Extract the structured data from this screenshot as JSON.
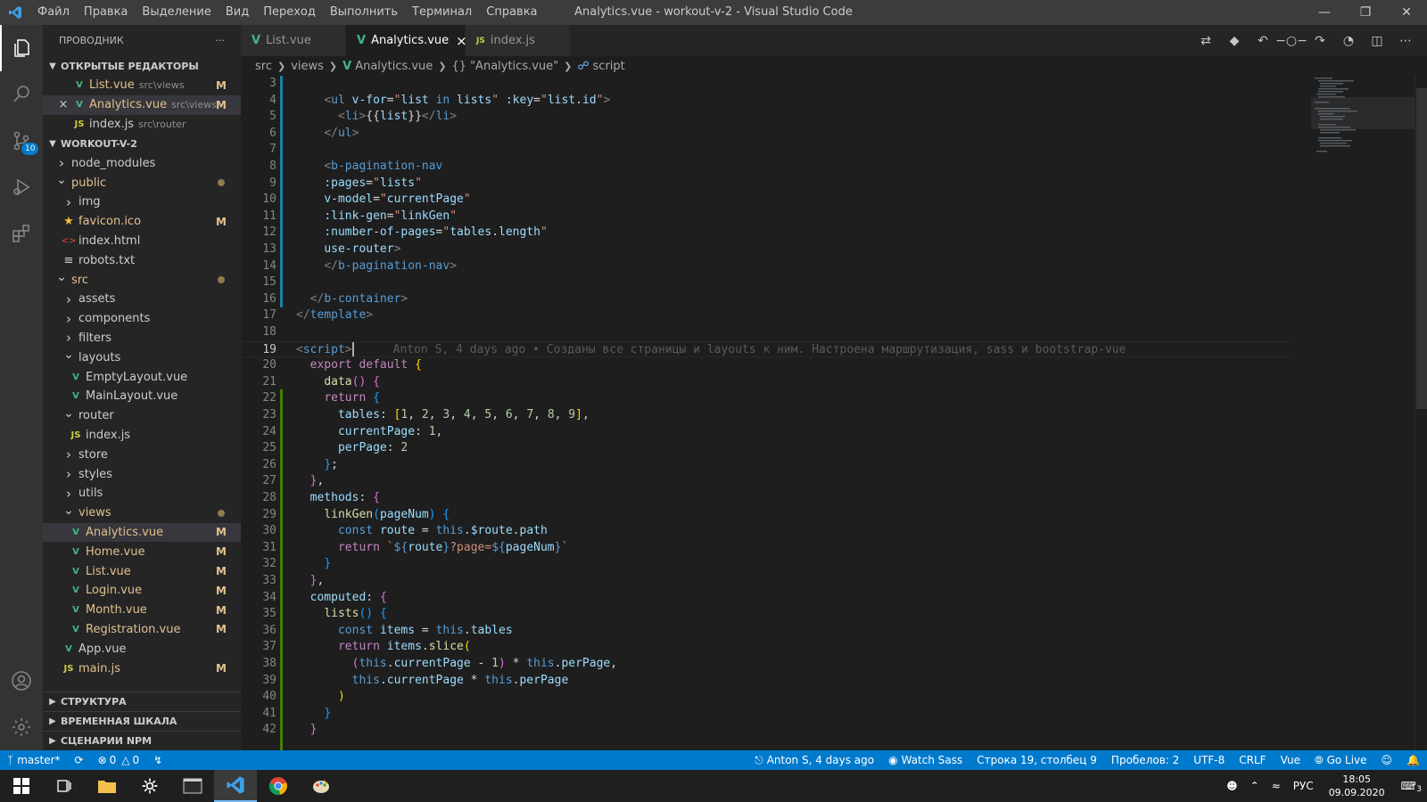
{
  "titlebar": {
    "menu": [
      "Файл",
      "Правка",
      "Выделение",
      "Вид",
      "Переход",
      "Выполнить",
      "Терминал",
      "Справка"
    ],
    "title": "Analytics.vue - workout-v-2 - Visual Studio Code"
  },
  "activity": {
    "scm_badge": "10"
  },
  "sidebar": {
    "header": "ПРОВОДНИК",
    "more": "···",
    "open_editors_title": "ОТКРЫТЫЕ РЕДАКТОРЫ",
    "open_editors": [
      {
        "name": "List.vue",
        "path": "src\\views",
        "mark": "M",
        "type": "vue"
      },
      {
        "name": "Analytics.vue",
        "path": "src\\views",
        "mark": "M",
        "type": "vue"
      },
      {
        "name": "index.js",
        "path": "src\\router",
        "mark": "",
        "type": "js"
      }
    ],
    "project_title": "WORKOUT-V-2",
    "tree": [
      {
        "name": "node_modules",
        "type": "folder-closed",
        "depth": 0
      },
      {
        "name": "public",
        "type": "folder-open",
        "depth": 0,
        "modified": true,
        "dot": true
      },
      {
        "name": "img",
        "type": "folder-closed",
        "depth": 1
      },
      {
        "name": "favicon.ico",
        "type": "star",
        "depth": 1,
        "modified": true,
        "mark": "M"
      },
      {
        "name": "index.html",
        "type": "html",
        "depth": 1
      },
      {
        "name": "robots.txt",
        "type": "txt",
        "depth": 1
      },
      {
        "name": "src",
        "type": "folder-open",
        "depth": 0,
        "modified": true,
        "dot": true
      },
      {
        "name": "assets",
        "type": "folder-closed",
        "depth": 1
      },
      {
        "name": "components",
        "type": "folder-closed",
        "depth": 1
      },
      {
        "name": "filters",
        "type": "folder-closed",
        "depth": 1
      },
      {
        "name": "layouts",
        "type": "folder-open",
        "depth": 1
      },
      {
        "name": "EmptyLayout.vue",
        "type": "vue",
        "depth": 2
      },
      {
        "name": "MainLayout.vue",
        "type": "vue",
        "depth": 2
      },
      {
        "name": "router",
        "type": "folder-open",
        "depth": 1
      },
      {
        "name": "index.js",
        "type": "js",
        "depth": 2
      },
      {
        "name": "store",
        "type": "folder-closed",
        "depth": 1
      },
      {
        "name": "styles",
        "type": "folder-closed",
        "depth": 1
      },
      {
        "name": "utils",
        "type": "folder-closed",
        "depth": 1
      },
      {
        "name": "views",
        "type": "folder-open",
        "depth": 1,
        "modified": true,
        "dot": true
      },
      {
        "name": "Analytics.vue",
        "type": "vue",
        "depth": 2,
        "modified": true,
        "mark": "M",
        "selected": true
      },
      {
        "name": "Home.vue",
        "type": "vue",
        "depth": 2,
        "modified": true,
        "mark": "M"
      },
      {
        "name": "List.vue",
        "type": "vue",
        "depth": 2,
        "modified": true,
        "mark": "M"
      },
      {
        "name": "Login.vue",
        "type": "vue",
        "depth": 2,
        "modified": true,
        "mark": "M"
      },
      {
        "name": "Month.vue",
        "type": "vue",
        "depth": 2,
        "modified": true,
        "mark": "M"
      },
      {
        "name": "Registration.vue",
        "type": "vue",
        "depth": 2,
        "modified": true,
        "mark": "M"
      },
      {
        "name": "App.vue",
        "type": "vue",
        "depth": 1
      },
      {
        "name": "main.js",
        "type": "js",
        "depth": 1,
        "modified": true,
        "mark": "M"
      }
    ],
    "bottom_sections": [
      "СТРУКТУРА",
      "ВРЕМЕННАЯ ШКАЛА",
      "СЦЕНАРИИ NPM"
    ]
  },
  "tabs": [
    {
      "label": "List.vue",
      "type": "vue",
      "active": false
    },
    {
      "label": "Analytics.vue",
      "type": "vue",
      "active": true
    },
    {
      "label": "index.js",
      "type": "js",
      "active": false
    }
  ],
  "breadcrumbs": [
    "src",
    "views",
    "Analytics.vue",
    "\"Analytics.vue\"",
    "script"
  ],
  "editor": {
    "blame": "Anton S, 4 days ago • Созданы все страницы и layouts к ним. Настроена маршрутизация, sass и bootstrap-vue",
    "lines": [
      {
        "n": "3",
        "html": ""
      },
      {
        "n": "4",
        "html": "    <span class='t-tag'>&lt;</span><span class='t-tagn'>ul</span> <span class='t-attr'>v-for</span>=<span class='t-str'>\"</span><span class='t-var'>list</span> <span class='t-kw2'>in</span> <span class='t-var'>lists</span><span class='t-str'>\"</span> <span class='t-attr'>:key</span>=<span class='t-str'>\"</span><span class='t-var'>list</span>.<span class='t-var'>id</span><span class='t-str'>\"</span><span class='t-tag'>&gt;</span>"
      },
      {
        "n": "5",
        "html": "      <span class='t-tag'>&lt;</span><span class='t-tagn'>li</span><span class='t-tag'>&gt;</span>{{<span class='t-var'>list</span>}}<span class='t-tag'>&lt;/</span><span class='t-tagn'>li</span><span class='t-tag'>&gt;</span>"
      },
      {
        "n": "6",
        "html": "    <span class='t-tag'>&lt;/</span><span class='t-tagn'>ul</span><span class='t-tag'>&gt;</span>"
      },
      {
        "n": "7",
        "html": ""
      },
      {
        "n": "8",
        "html": "    <span class='t-tag'>&lt;</span><span class='t-tagn'>b-pagination-nav</span>"
      },
      {
        "n": "9",
        "html": "    <span class='t-attr'>:pages</span>=<span class='t-str'>\"</span><span class='t-var'>lists</span><span class='t-str'>\"</span>"
      },
      {
        "n": "10",
        "html": "    <span class='t-attr'>v-model</span>=<span class='t-str'>\"</span><span class='t-var'>currentPage</span><span class='t-str'>\"</span>"
      },
      {
        "n": "11",
        "html": "    <span class='t-attr'>:link-gen</span>=<span class='t-str'>\"</span><span class='t-var'>linkGen</span><span class='t-str'>\"</span>"
      },
      {
        "n": "12",
        "html": "    <span class='t-attr'>:number-of-pages</span>=<span class='t-str'>\"</span><span class='t-var'>tables</span>.<span class='t-var'>length</span><span class='t-str'>\"</span>"
      },
      {
        "n": "13",
        "html": "    <span class='t-attr'>use-router</span><span class='t-tag'>&gt;</span>"
      },
      {
        "n": "14",
        "html": "    <span class='t-tag'>&lt;/</span><span class='t-tagn'>b-pagination-nav</span><span class='t-tag'>&gt;</span>"
      },
      {
        "n": "15",
        "html": ""
      },
      {
        "n": "16",
        "html": "  <span class='t-tag'>&lt;/</span><span class='t-tagn'>b-container</span><span class='t-tag'>&gt;</span>"
      },
      {
        "n": "17",
        "html": "<span class='t-tag'>&lt;/</span><span class='t-tagn'>template</span><span class='t-tag'>&gt;</span>"
      },
      {
        "n": "18",
        "html": ""
      },
      {
        "n": "19",
        "html": "<span class='t-tag'>&lt;</span><span class='t-tagn'>script</span><span class='t-tag'>&gt;</span><span class='cursor'></span>",
        "current": true
      },
      {
        "n": "20",
        "html": "  <span class='t-kw'>export</span> <span class='t-kw'>default</span> <span class='t-br1'>{</span>"
      },
      {
        "n": "21",
        "html": "    <span class='t-fn'>data</span><span class='t-br2'>()</span> <span class='t-br2'>{</span>"
      },
      {
        "n": "22",
        "html": "    <span class='t-kw'>return</span> <span class='t-br3'>{</span>"
      },
      {
        "n": "23",
        "html": "      <span class='t-var'>tables</span>: <span class='t-br1'>[</span><span class='t-num'>1</span>, <span class='t-num'>2</span>, <span class='t-num'>3</span>, <span class='t-num'>4</span>, <span class='t-num'>5</span>, <span class='t-num'>6</span>, <span class='t-num'>7</span>, <span class='t-num'>8</span>, <span class='t-num'>9</span><span class='t-br1'>]</span>,"
      },
      {
        "n": "24",
        "html": "      <span class='t-var'>currentPage</span>: <span class='t-num'>1</span>,"
      },
      {
        "n": "25",
        "html": "      <span class='t-var'>perPage</span>: <span class='t-num'>2</span>"
      },
      {
        "n": "26",
        "html": "    <span class='t-br3'>}</span>;"
      },
      {
        "n": "27",
        "html": "  <span class='t-br2'>}</span>,"
      },
      {
        "n": "28",
        "html": "  <span class='t-var'>methods</span>: <span class='t-br2'>{</span>"
      },
      {
        "n": "29",
        "html": "    <span class='t-fn'>linkGen</span><span class='t-br3'>(</span><span class='t-var'>pageNum</span><span class='t-br3'>)</span> <span class='t-br3'>{</span>"
      },
      {
        "n": "30",
        "html": "      <span class='t-kw2'>const</span> <span class='t-var'>route</span> = <span class='t-kw2'>this</span>.<span class='t-var'>$route</span>.<span class='t-var'>path</span>"
      },
      {
        "n": "31",
        "html": "      <span class='t-kw'>return</span> <span class='t-tpl'>`</span><span class='t-kw2'>${</span><span class='t-var'>route</span><span class='t-kw2'>}</span><span class='t-tpl'>?page=</span><span class='t-kw2'>${</span><span class='t-var'>pageNum</span><span class='t-kw2'>}</span><span class='t-tpl'>`</span>"
      },
      {
        "n": "32",
        "html": "    <span class='t-br3'>}</span>"
      },
      {
        "n": "33",
        "html": "  <span class='t-br2'>}</span>,"
      },
      {
        "n": "34",
        "html": "  <span class='t-var'>computed</span>: <span class='t-br2'>{</span>"
      },
      {
        "n": "35",
        "html": "    <span class='t-fn'>lists</span><span class='t-br3'>()</span> <span class='t-br3'>{</span>"
      },
      {
        "n": "36",
        "html": "      <span class='t-kw2'>const</span> <span class='t-var'>items</span> = <span class='t-kw2'>this</span>.<span class='t-var'>tables</span>"
      },
      {
        "n": "37",
        "html": "      <span class='t-kw'>return</span> <span class='t-var'>items</span>.<span class='t-fn'>slice</span><span class='t-br1'>(</span>"
      },
      {
        "n": "38",
        "html": "        <span class='t-br2'>(</span><span class='t-kw2'>this</span>.<span class='t-var'>currentPage</span> - <span class='t-num'>1</span><span class='t-br2'>)</span> * <span class='t-kw2'>this</span>.<span class='t-var'>perPage</span>,"
      },
      {
        "n": "39",
        "html": "        <span class='t-kw2'>this</span>.<span class='t-var'>currentPage</span> * <span class='t-kw2'>this</span>.<span class='t-var'>perPage</span>"
      },
      {
        "n": "40",
        "html": "      <span class='t-br1'>)</span>"
      },
      {
        "n": "41",
        "html": "    <span class='t-br3'>}</span>"
      },
      {
        "n": "42",
        "html": "  <span class='t-br2'>}</span>"
      }
    ]
  },
  "statusbar": {
    "branch": "master*",
    "errors": "0",
    "warnings": "0",
    "blame": "Anton S, 4 days ago",
    "watch_sass": "Watch Sass",
    "position": "Строка 19, столбец 9",
    "spaces": "Пробелов: 2",
    "encoding": "UTF-8",
    "eol": "CRLF",
    "language": "Vue",
    "golive": "Go Live"
  },
  "taskbar": {
    "lang": "РУС",
    "time": "18:05",
    "date": "09.09.2020",
    "notif_count": "3"
  },
  "colors": {
    "accent": "#007acc",
    "vue": "#41b883",
    "modified": "#e2c08d"
  }
}
